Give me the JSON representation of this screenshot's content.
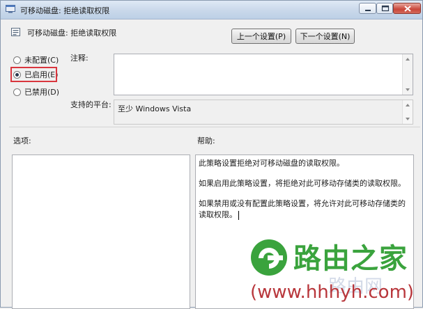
{
  "window": {
    "title": "可移动磁盘: 拒绝读取权限"
  },
  "header": {
    "policy_title": "可移动磁盘: 拒绝读取权限",
    "prev_button": "上一个设置(P)",
    "next_button": "下一个设置(N)"
  },
  "options": {
    "not_configured": "未配置(C)",
    "enabled": "已启用(E)",
    "disabled": "已禁用(D)",
    "selected": "enabled"
  },
  "comment": {
    "label": "注释:",
    "value": ""
  },
  "platform": {
    "label": "支持的平台:",
    "value": "至少 Windows Vista"
  },
  "panes": {
    "options_label": "选项:",
    "help_label": "帮助:"
  },
  "help": {
    "paragraphs": [
      "此策略设置拒绝对可移动磁盘的读取权限。",
      "如果启用此策略设置，将拒绝对此可移动存储类的读取权限。",
      "如果禁用或没有配置此策略设置，将允许对此可移动存储类的读取权限。"
    ]
  },
  "watermark": {
    "name": "路由之家",
    "url": "(www.hhhyh.com)",
    "faint": "路由网"
  },
  "colors": {
    "highlight": "#d9363e",
    "watermark_green": "#3aa33d",
    "watermark_red": "#b8363b"
  },
  "icons": {
    "title": "policy-window-icon",
    "header": "policy-setting-icon",
    "watermark": "router-logo-icon"
  }
}
